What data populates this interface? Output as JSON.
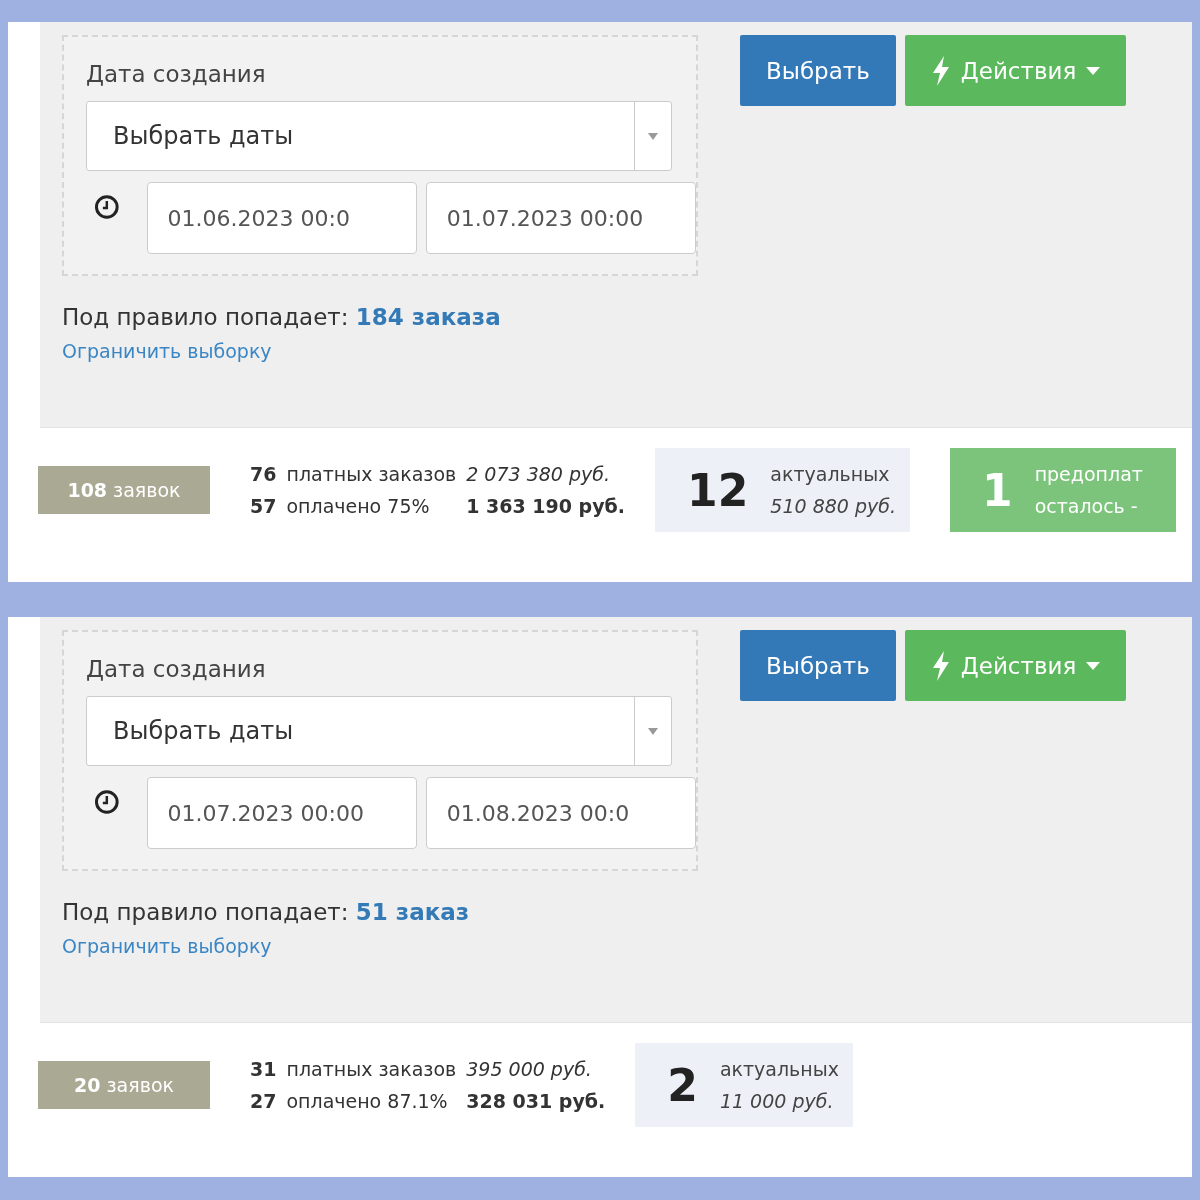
{
  "panels": [
    {
      "filter": {
        "label": "Дата создания",
        "select": {
          "placeholder": "Выбрать даты"
        },
        "date_from": "01.06.2023 00:0",
        "date_to": "01.07.2023 00:00"
      },
      "match": "Под правило попадает: **184 заказа**",
      "limit_link": "Ограничить выборку",
      "buttons": [
        {
          "kind": "primary",
          "label": "Выбрать"
        },
        {
          "kind": "actions",
          "label": "Действия"
        }
      ],
      "stats": {
        "requests": "**108** заявок",
        "rows": [
          {
            "count": "76",
            "label": "платных заказов",
            "sum": "2 073 380 руб.",
            "kind": "italic"
          },
          {
            "count": "57",
            "label": "оплачено 75%",
            "sum": "1 363 190 руб.",
            "kind": "bold"
          }
        ],
        "cards": [
          {
            "kind": "actual",
            "number": "12",
            "label": "актуальных",
            "sum": "510 880 руб."
          },
          {
            "kind": "prepaid",
            "number": "1",
            "label": "предоплат",
            "sum": "осталось -"
          }
        ]
      }
    },
    {
      "filter": {
        "label": "Дата создания",
        "select": {
          "placeholder": "Выбрать даты"
        },
        "date_from": "01.07.2023 00:00",
        "date_to": "01.08.2023 00:0"
      },
      "match": "Под правило попадает: **51 заказ**",
      "limit_link": "Ограничить выборку",
      "buttons": [
        {
          "kind": "primary",
          "label": "Выбрать"
        },
        {
          "kind": "actions",
          "label": "Действия"
        }
      ],
      "stats": {
        "requests": "**20** заявок",
        "rows": [
          {
            "count": "31",
            "label": "платных заказов",
            "sum": "395 000 руб.",
            "kind": "italic"
          },
          {
            "count": "27",
            "label": "оплачено 87.1%",
            "sum": "328 031 руб.",
            "kind": "bold"
          }
        ],
        "cards": [
          {
            "kind": "actual",
            "number": "2",
            "label": "актуальных",
            "sum": "11 000 руб."
          }
        ]
      }
    }
  ]
}
